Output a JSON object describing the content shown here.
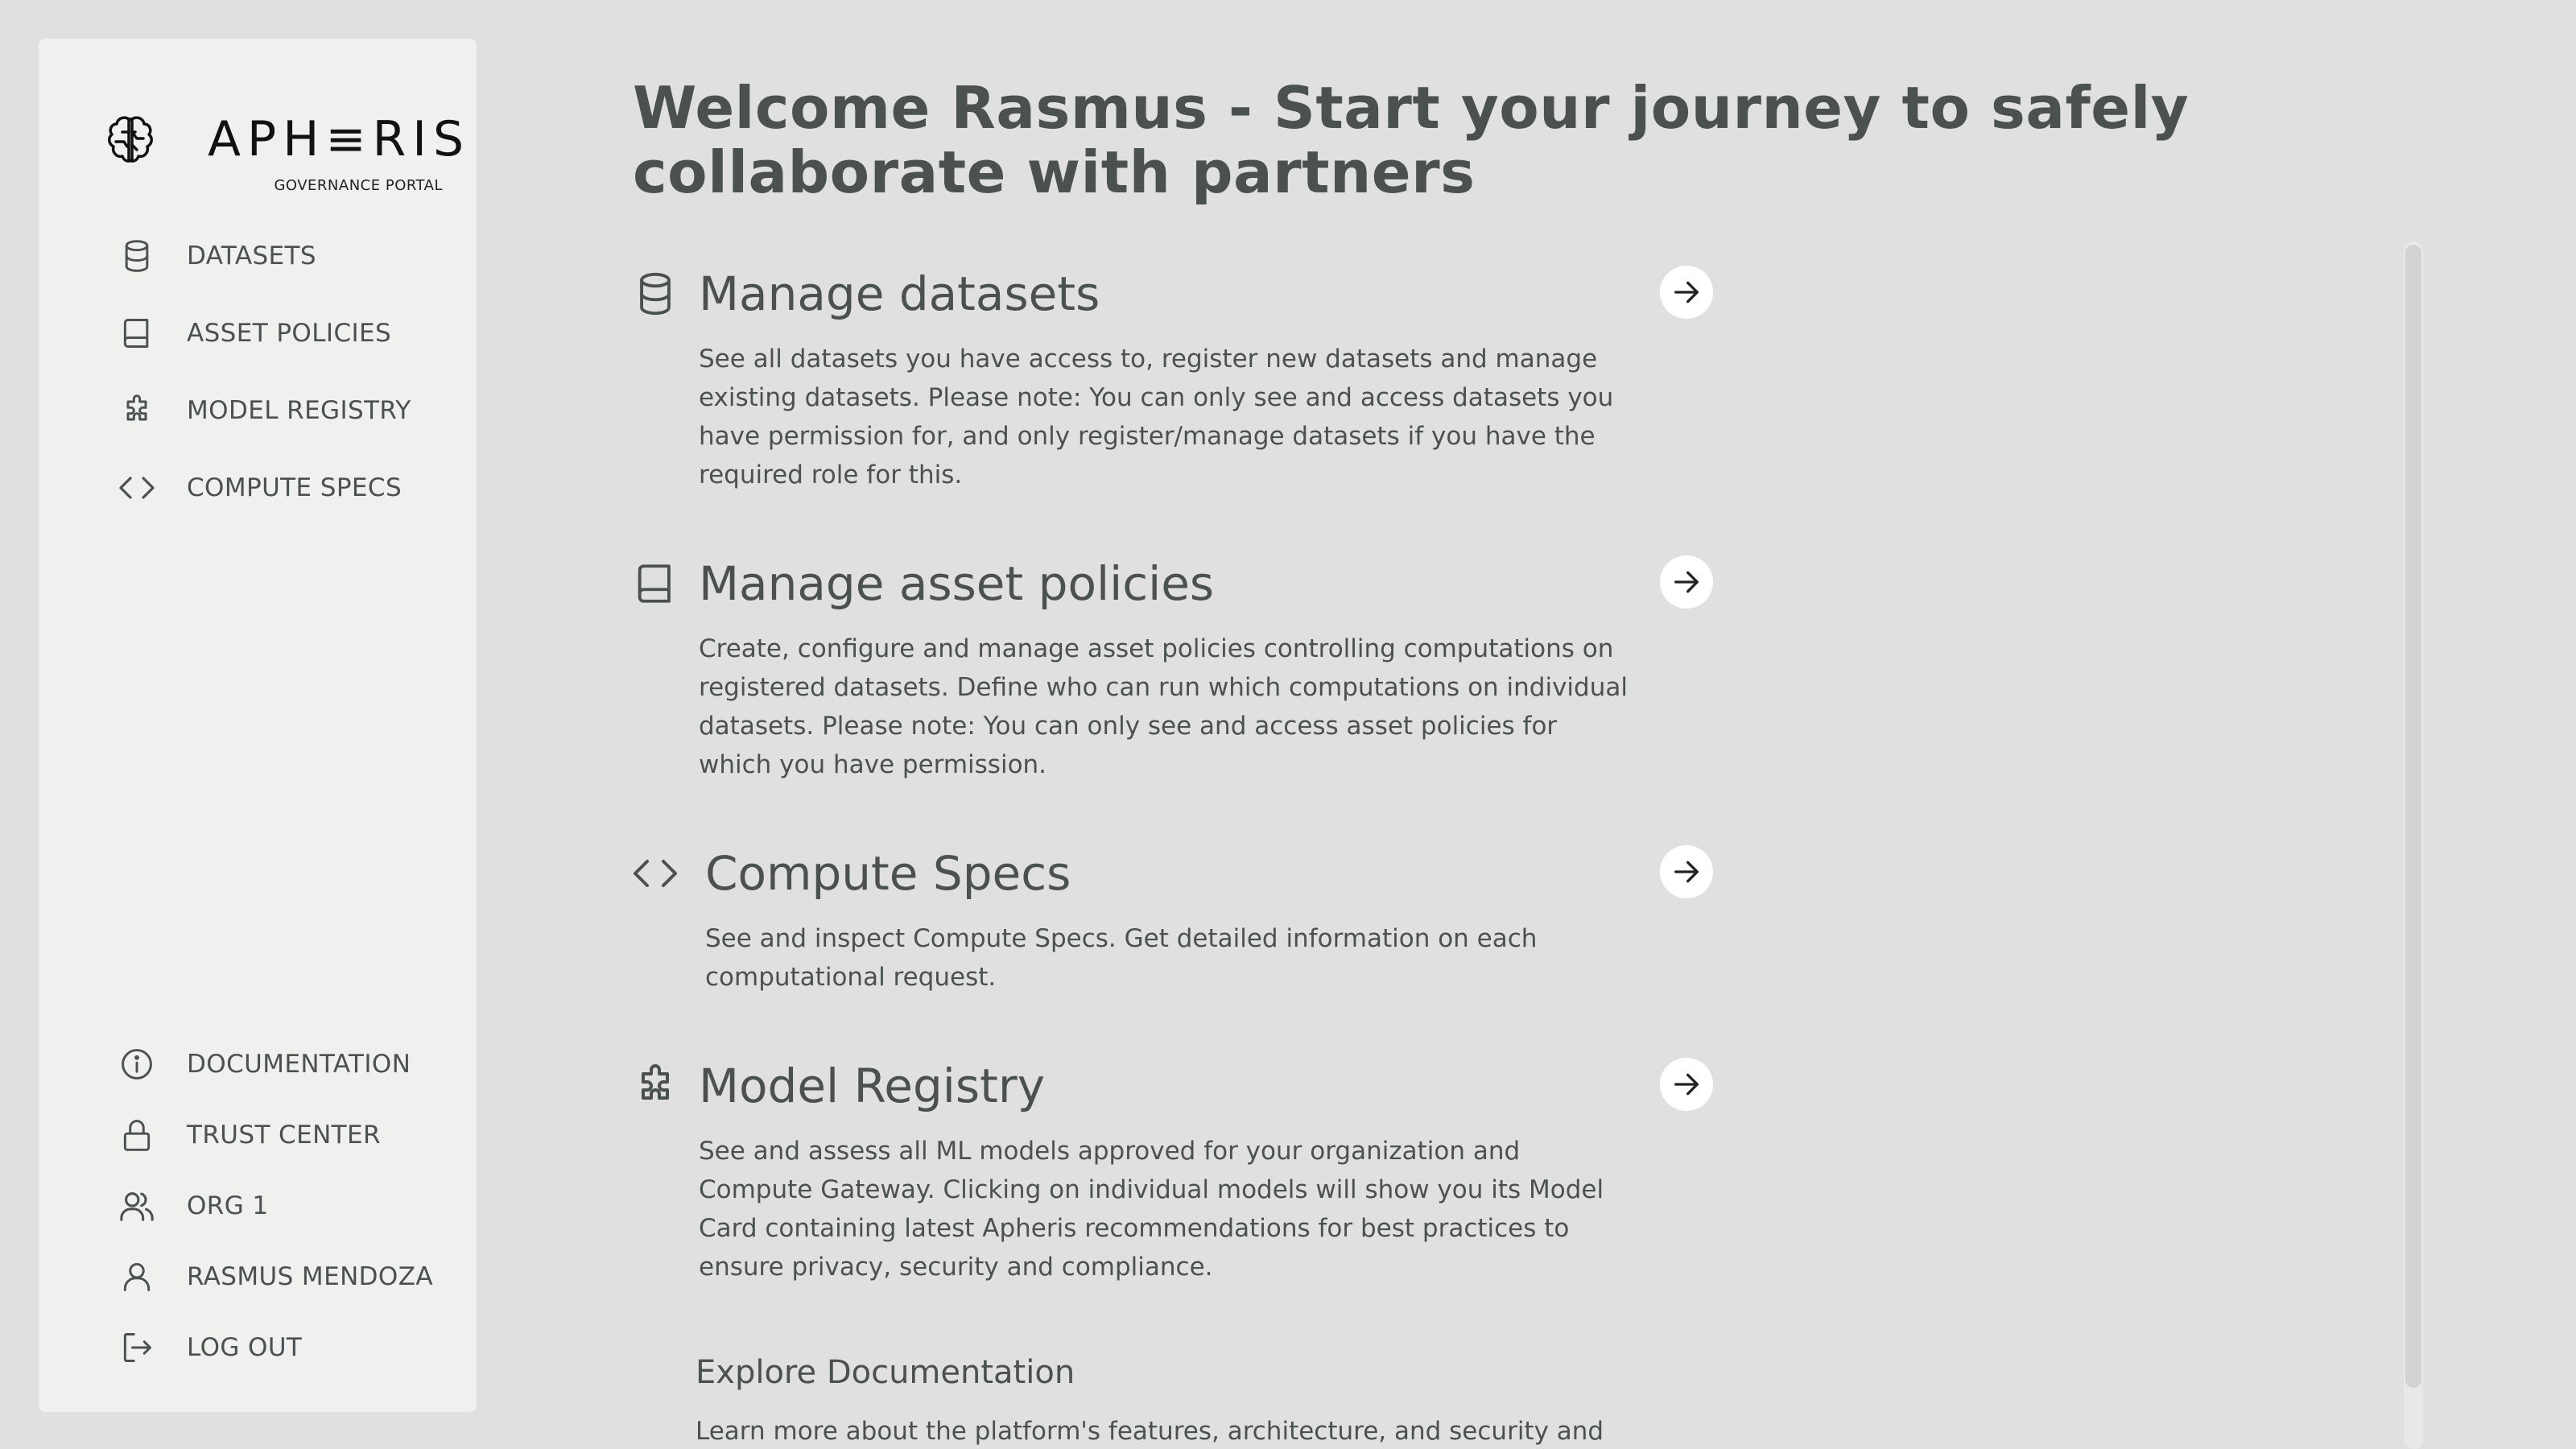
{
  "brand": {
    "name": "APH≡RIS",
    "subtitle": "GOVERNANCE PORTAL"
  },
  "sidebar": {
    "top_items": [
      {
        "label": "DATASETS",
        "icon": "database-icon"
      },
      {
        "label": "ASSET POLICIES",
        "icon": "book-icon"
      },
      {
        "label": "MODEL REGISTRY",
        "icon": "puzzle-icon"
      },
      {
        "label": "COMPUTE SPECS",
        "icon": "code-brackets-icon"
      }
    ],
    "bottom_items": [
      {
        "label": "DOCUMENTATION",
        "icon": "info-icon"
      },
      {
        "label": "TRUST CENTER",
        "icon": "lock-icon"
      },
      {
        "label": "ORG 1",
        "icon": "users-icon"
      },
      {
        "label": "RASMUS MENDOZA",
        "icon": "user-icon"
      },
      {
        "label": "LOG OUT",
        "icon": "logout-icon"
      }
    ]
  },
  "main": {
    "title": "Welcome Rasmus - Start your journey to safely collaborate with partners",
    "cards": [
      {
        "title": "Manage datasets",
        "icon": "database-icon",
        "description": "See all datasets you have access to, register new datasets and manage existing datasets. Please note: You can only see and access datasets you have permission for, and only register/manage datasets if you have the required role for this."
      },
      {
        "title": "Manage asset policies",
        "icon": "book-icon",
        "description": "Create, configure and manage asset policies controlling computations on registered datasets. Define who can run which computations on individual datasets. Please note: You can only see and access asset policies for which you have permission."
      },
      {
        "title": "Compute Specs",
        "icon": "code-brackets-icon",
        "description": "See and inspect Compute Specs. Get detailed information on each computational request."
      },
      {
        "title": "Model Registry",
        "icon": "puzzle-icon",
        "description": "See and assess all ML models approved for your organization and Compute Gateway. Clicking on individual models will show you its Model Card containing latest Apheris recommendations for best practices to ensure privacy, security and compliance."
      }
    ],
    "explore": {
      "title": "Explore Documentation",
      "description": "Learn more about the platform's features, architecture, and security and"
    }
  },
  "colors": {
    "background": "#e0e0e0",
    "sidebar": "#f0f0ef",
    "text": "#4a5150",
    "arrow_button": "#ffffff"
  }
}
